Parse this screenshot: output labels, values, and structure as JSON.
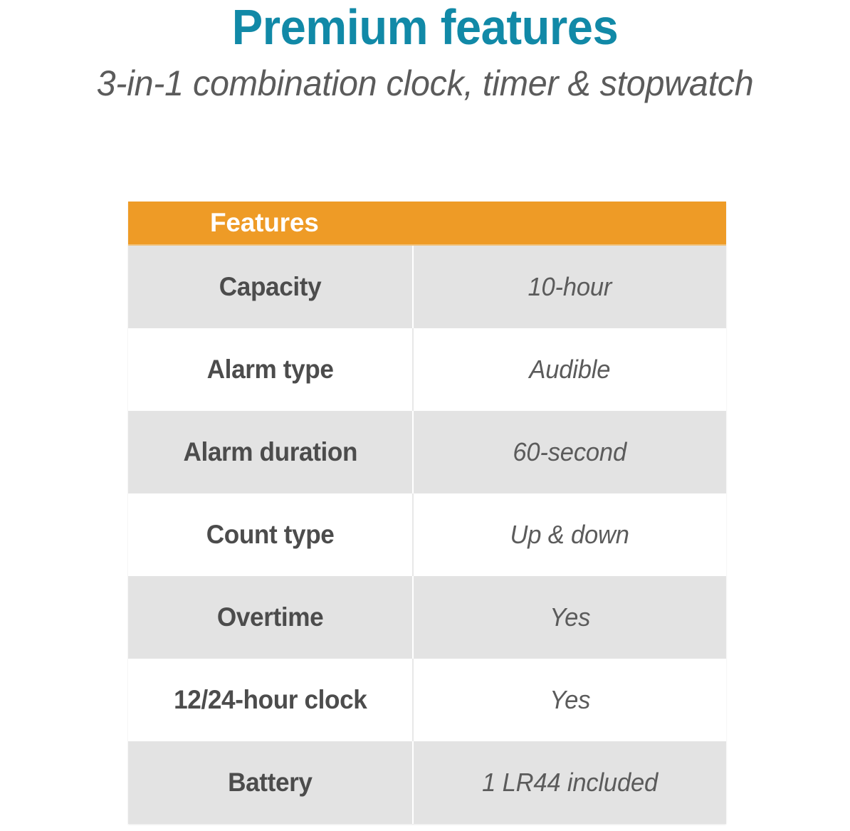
{
  "header": {
    "title": "Premium features",
    "subtitle": "3-in-1 combination clock, timer & stopwatch",
    "title_color": "#1189a7",
    "subtitle_color": "#5b5b5b"
  },
  "table": {
    "header_label": "Features",
    "header_bg_color": "#ee9b26",
    "header_text_color": "#ffffff",
    "shaded_row_color": "#e3e3e3",
    "plain_row_color": "#ffffff",
    "label_text_color": "#4c4c4c",
    "value_text_color": "#5b5b5b",
    "columns": [
      "Features",
      ""
    ],
    "rows": [
      {
        "label": "Capacity",
        "value": "10-hour"
      },
      {
        "label": "Alarm type",
        "value": "Audible"
      },
      {
        "label": "Alarm duration",
        "value": "60-second"
      },
      {
        "label": "Count type",
        "value": "Up & down"
      },
      {
        "label": "Overtime",
        "value": "Yes"
      },
      {
        "label": "12/24-hour clock",
        "value": "Yes"
      },
      {
        "label": "Battery",
        "value": "1 LR44 included"
      }
    ]
  }
}
